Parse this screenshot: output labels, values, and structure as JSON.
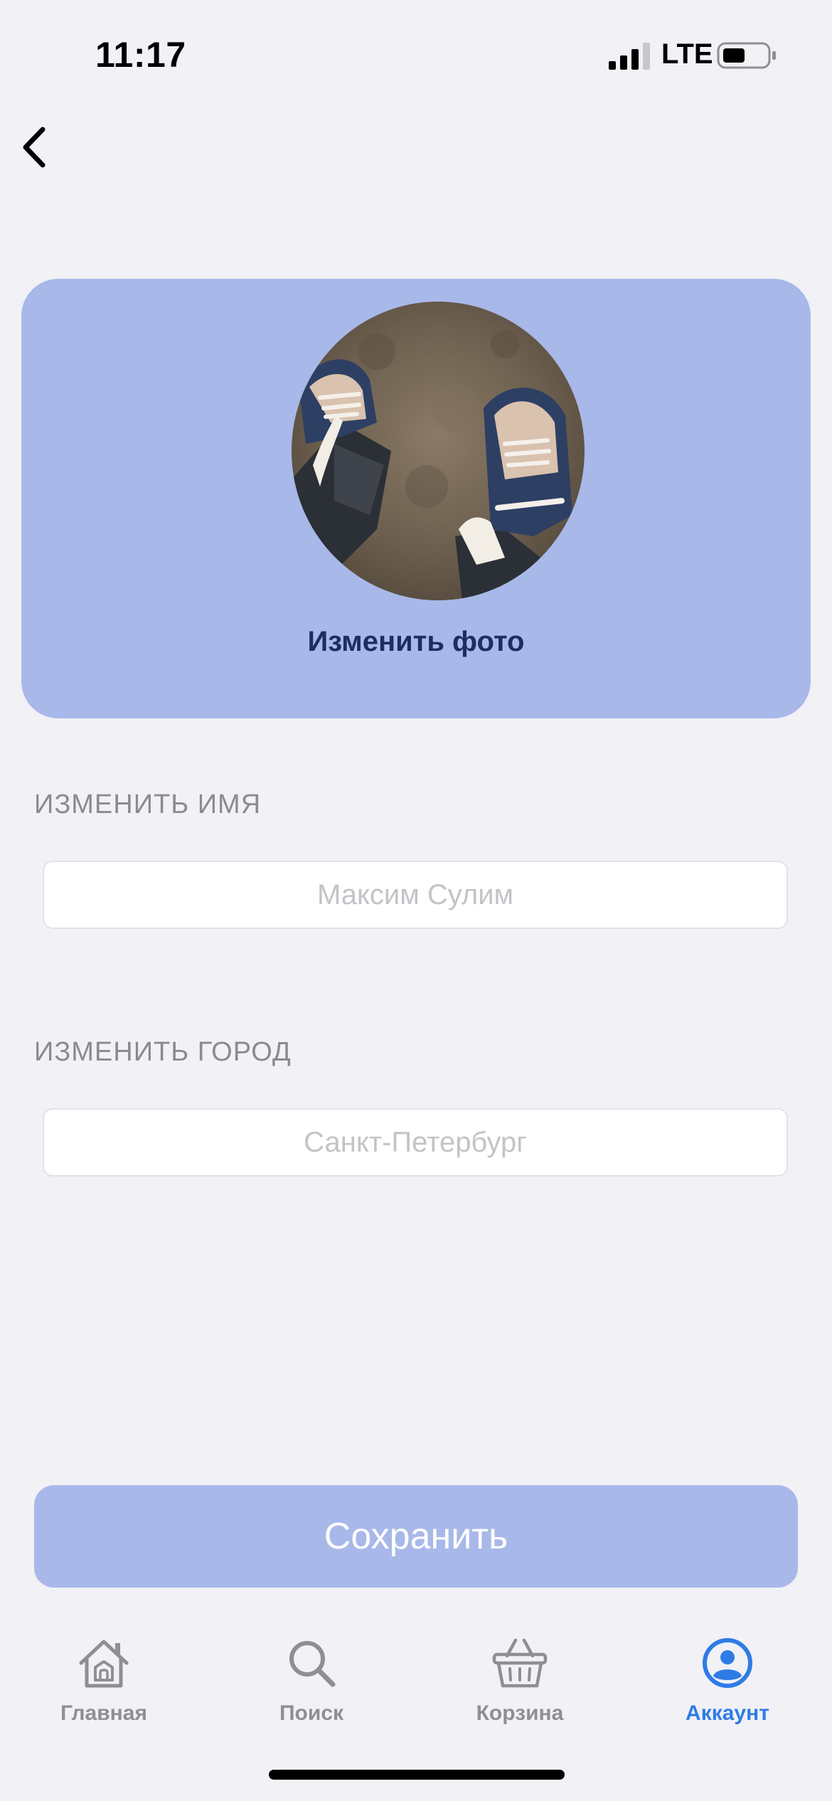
{
  "status_bar": {
    "time": "11:17",
    "network": "LTE"
  },
  "profile_photo": {
    "change_label": "Изменить фото"
  },
  "name_section": {
    "label": "ИЗМЕНИТЬ ИМЯ",
    "placeholder": "Максим Сулим",
    "value": ""
  },
  "city_section": {
    "label": "ИЗМЕНИТЬ ГОРОД",
    "placeholder": "Санкт-Петербург",
    "value": ""
  },
  "save_button": {
    "label": "Сохранить"
  },
  "tab_bar": {
    "items": [
      {
        "label": "Главная",
        "icon": "home-icon",
        "active": false
      },
      {
        "label": "Поиск",
        "icon": "search-icon",
        "active": false
      },
      {
        "label": "Корзина",
        "icon": "basket-icon",
        "active": false
      },
      {
        "label": "Аккаунт",
        "icon": "account-icon",
        "active": true
      }
    ]
  },
  "colors": {
    "background": "#F1F1F6",
    "accent_light": "#A8B8E9",
    "accent_active": "#2F7BE5",
    "inactive": "#8E8E93"
  }
}
